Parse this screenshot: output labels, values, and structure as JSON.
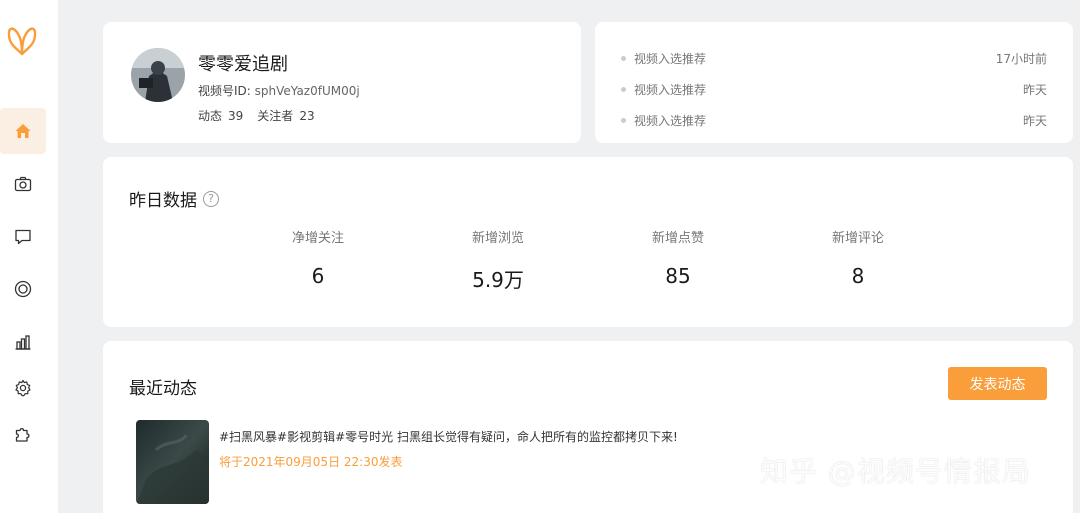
{
  "colors": {
    "accent": "#fa9d3b",
    "active_bg": "#fbeee2",
    "page_bg": "#eef0f2"
  },
  "sidebar": {
    "logo": "butterfly-logo",
    "items": [
      {
        "icon": "home-icon",
        "active": true
      },
      {
        "icon": "camera-icon",
        "active": false
      },
      {
        "icon": "message-icon",
        "active": false
      },
      {
        "icon": "live-icon",
        "active": false
      },
      {
        "icon": "chart-icon",
        "active": false
      },
      {
        "icon": "gear-icon",
        "active": false
      },
      {
        "icon": "puzzle-icon",
        "active": false
      }
    ]
  },
  "profile": {
    "name": "零零爱追剧",
    "id_label": "视频号ID: ",
    "id_value": "sphVeYaz0fUM00j",
    "posts_label": "动态",
    "posts_count": "39",
    "followers_label": "关注者",
    "followers_count": "23"
  },
  "notifications": [
    {
      "text": "视频入选推荐",
      "time": "17小时前"
    },
    {
      "text": "视频入选推荐",
      "time": "昨天"
    },
    {
      "text": "视频入选推荐",
      "time": "昨天"
    }
  ],
  "yesterday": {
    "title": "昨日数据",
    "help_glyph": "?",
    "stats": [
      {
        "label": "净增关注",
        "value": "6"
      },
      {
        "label": "新增浏览",
        "value": "5.9万"
      },
      {
        "label": "新增点赞",
        "value": "85"
      },
      {
        "label": "新增评论",
        "value": "8"
      }
    ]
  },
  "recent": {
    "title": "最近动态",
    "post_button": "发表动态",
    "post": {
      "text": "#扫黑风暴#影视剪辑#零号时光 扫黑组长觉得有疑问，命人把所有的监控都拷贝下来!",
      "schedule": "将于2021年09月05日 22:30发表"
    }
  },
  "watermark": "知乎 @视频号情报局"
}
